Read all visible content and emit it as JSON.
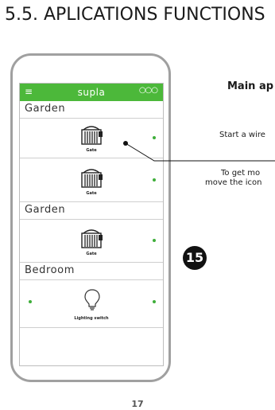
{
  "heading": "5.5. APLICATIONS FUNCTIONS",
  "app": {
    "title": "supla",
    "menu_icon": "hamburger-icon",
    "more_icon": "more-icon",
    "accent": "#4cb83a",
    "sections": [
      {
        "label": "Garden"
      },
      {
        "label": "Garden"
      },
      {
        "label": "Bedroom"
      }
    ],
    "rows": [
      {
        "caption": "Gate",
        "icon": "gate-icon"
      },
      {
        "caption": "Gate",
        "icon": "gate-icon"
      },
      {
        "caption": "Gate",
        "icon": "gate-icon"
      },
      {
        "caption": "Lighting switch",
        "icon": "bulb-icon"
      }
    ]
  },
  "callout_number": "15",
  "side_text": {
    "title": "Main ap",
    "line1": "Start a wire",
    "line2": "To get mo",
    "line3": "move the icon"
  },
  "page_number": "17"
}
